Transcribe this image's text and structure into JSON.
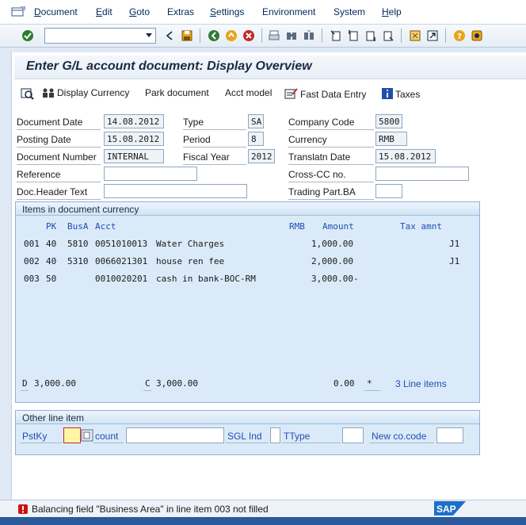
{
  "menu": {
    "items": [
      {
        "label": "Document",
        "u": "D",
        "rest": "ocument"
      },
      {
        "label": "Edit",
        "u": "E",
        "rest": "dit"
      },
      {
        "label": "Goto",
        "u": "G",
        "rest": "oto"
      },
      {
        "label": "Extras",
        "u": "",
        "rest": "Extras"
      },
      {
        "label": "Settings",
        "u": "S",
        "rest": "ettings"
      },
      {
        "label": "Environment",
        "u": "",
        "rest": "Environment"
      },
      {
        "label": "System",
        "u": "",
        "rest": "System"
      },
      {
        "label": "Help",
        "u": "H",
        "rest": "elp"
      }
    ]
  },
  "page_title": "Enter G/L account document: Display Overview",
  "app_toolbar": {
    "display_currency": "Display Currency",
    "park_document": "Park document",
    "acct_model": "Acct model",
    "fast_data_entry": "Fast Data Entry",
    "taxes": "Taxes"
  },
  "header": {
    "document_date_label": "Document Date",
    "document_date": "14.08.2012",
    "posting_date_label": "Posting Date",
    "posting_date": "15.08.2012",
    "document_number_label": "Document Number",
    "document_number": "INTERNAL",
    "reference_label": "Reference",
    "doc_header_text_label": "Doc.Header Text",
    "type_label": "Type",
    "type": "SA",
    "period_label": "Period",
    "period": "8",
    "fiscal_year_label": "Fiscal Year",
    "fiscal_year": "2012",
    "company_code_label": "Company Code",
    "company_code": "5800",
    "currency_label": "Currency",
    "currency": "RMB",
    "translatn_date_label": "Translatn Date",
    "translatn_date": "15.08.2012",
    "cross_cc_label": "Cross-CC no.",
    "trading_part_label": "Trading Part.BA"
  },
  "items_group": {
    "title": "Items in document currency",
    "columns": {
      "pk": "PK",
      "busa": "BusA",
      "acct": "Acct",
      "rmb": "RMB",
      "amount": "Amount",
      "tax_amnt": "Tax amnt"
    },
    "rows": [
      {
        "line": "001",
        "pk": "40",
        "busa": "5810",
        "acct": "0051010013",
        "text": "Water Charges",
        "amount": "1,000.00",
        "tax": "J1"
      },
      {
        "line": "002",
        "pk": "40",
        "busa": "5310",
        "acct": "0066021301",
        "text": "house ren fee",
        "amount": "2,000.00",
        "tax": "J1"
      },
      {
        "line": "003",
        "pk": "50",
        "busa": "",
        "acct": "0010020201",
        "text": "cash in bank-BOC-RM",
        "amount": "3,000.00-",
        "tax": ""
      }
    ],
    "totals": {
      "d_label": "D",
      "d_value": "3,000.00",
      "c_label": "C",
      "c_value": "3,000.00",
      "diff": "0.00",
      "star": "*",
      "line_items": "3 Line items"
    }
  },
  "other_group": {
    "title": "Other line item",
    "pstky_label": "PstKy",
    "account_label": "count",
    "sgl_label": "SGL Ind",
    "ttype_label": "TType",
    "new_co_label": "New co.code"
  },
  "status": {
    "message": "Balancing field \"Business Area\" in line item 003 not filled",
    "type": "error"
  },
  "colors": {
    "accent": "#1f4fb0",
    "error": "#d01010"
  }
}
